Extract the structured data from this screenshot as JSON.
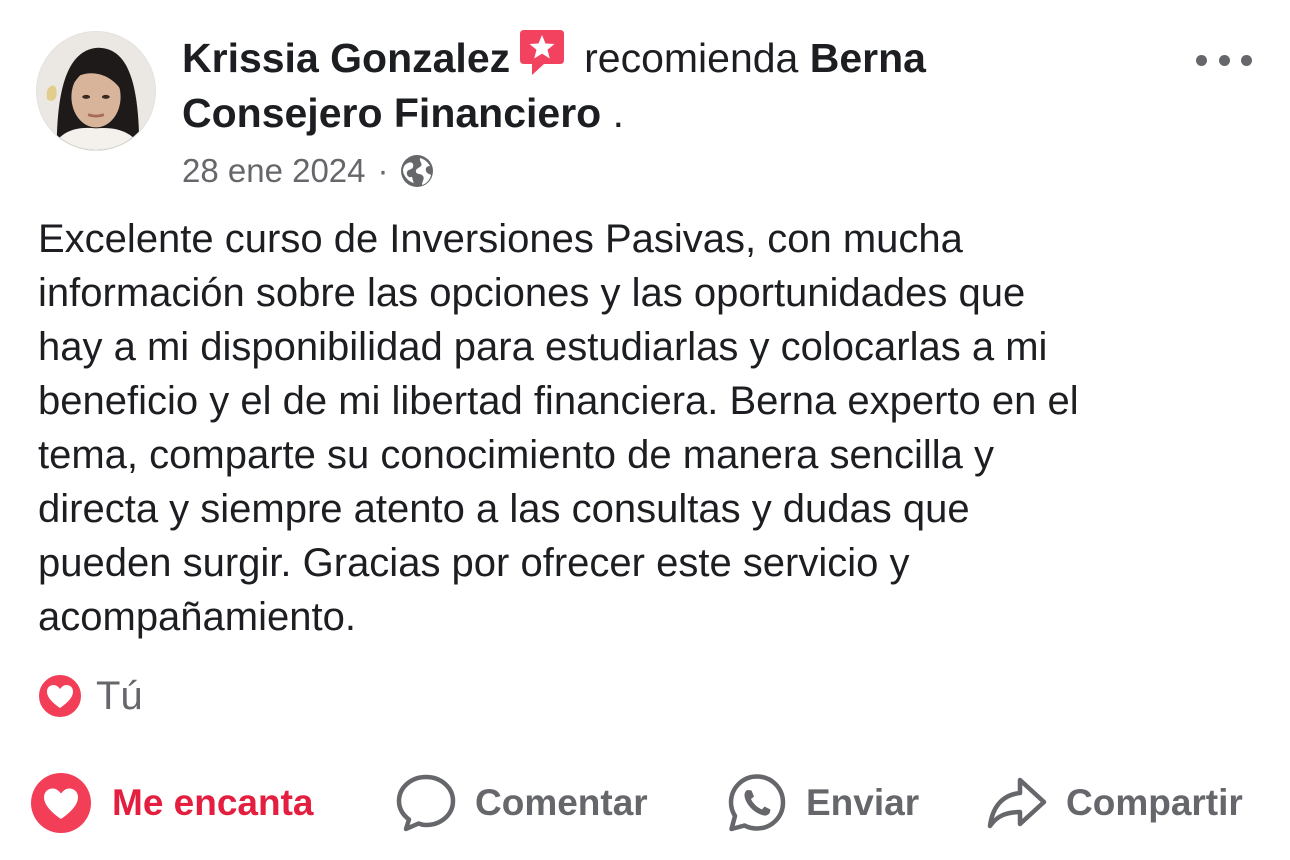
{
  "post": {
    "author": "Krissia Gonzalez",
    "verb": "recomienda",
    "page_name": "Berna Consejero Financiero",
    "period": ".",
    "date": "28 ene 2024",
    "separator": "·",
    "audience_icon": "globe-icon",
    "recommend_badge_icon": "recommend-star-badge-icon",
    "menu_icon": "more-options-icon",
    "text": "Excelente curso de Inversiones Pasivas, con mucha\ninformación sobre las opciones y las oportunidades que\nhay a mi disponibilidad para estudiarlas y colocarlas a mi\nbeneficio y el de mi libertad financiera. Berna experto en el\ntema, comparte su conocimiento de manera sencilla y\ndirecta y siempre atento a las consultas y dudas que\npueden surgir. Gracias por ofrecer este servicio y\nacompañamiento."
  },
  "reactions": {
    "icon": "love-reaction-icon",
    "summary": "Tú"
  },
  "actions": {
    "love": "Me encanta",
    "comment": "Comentar",
    "send": "Enviar",
    "share": "Compartir"
  },
  "colors": {
    "text": "#1c1e21",
    "secondary": "#65676b",
    "love": "#e41e3f",
    "badge": "#f3425f"
  }
}
